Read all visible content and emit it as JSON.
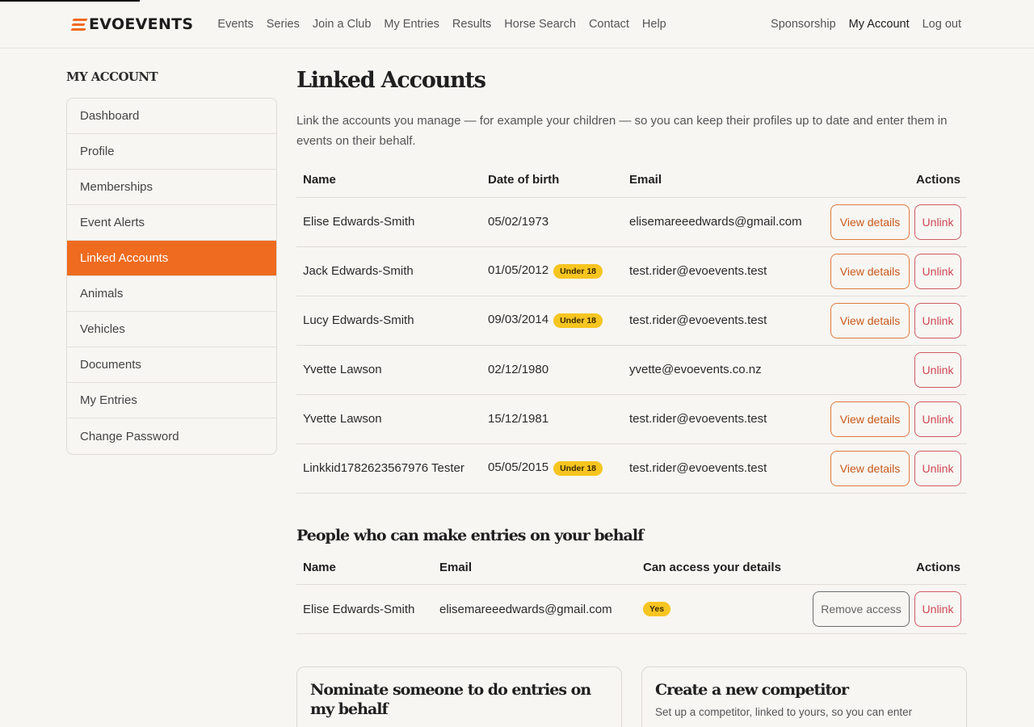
{
  "brand": {
    "name": "EVOEVENTS",
    "accent": "#ee6b1f"
  },
  "nav": {
    "items": [
      "Events",
      "Series",
      "Join a Club",
      "My Entries",
      "Results",
      "Horse Search",
      "Contact",
      "Help"
    ],
    "right": [
      "Sponsorship",
      "My Account",
      "Log out"
    ]
  },
  "sidebar": {
    "title": "MY ACCOUNT",
    "items": [
      "Dashboard",
      "Profile",
      "Memberships",
      "Event Alerts",
      "Linked Accounts",
      "Animals",
      "Vehicles",
      "Documents",
      "My Entries",
      "Change Password"
    ],
    "active": "Linked Accounts"
  },
  "main": {
    "title": "Linked Accounts",
    "intro": "Link the accounts you manage — for example your children — so you can keep their profiles up to date and enter them in events on their behalf.",
    "linked_table": {
      "headers": [
        "Name",
        "Date of birth",
        "Email",
        "Actions"
      ],
      "rows": [
        {
          "name": "Elise Edwards-Smith",
          "dob": "05/02/1973",
          "badge": "",
          "email": "elisemareeedwards@gmail.com",
          "view": "View details",
          "unlink": "Unlink"
        },
        {
          "name": "Jack Edwards-Smith",
          "dob": "01/05/2012",
          "badge": "Under 18",
          "email": "test.rider@evoevents.test",
          "view": "View details",
          "unlink": "Unlink"
        },
        {
          "name": "Lucy Edwards-Smith",
          "dob": "09/03/2014",
          "badge": "Under 18",
          "email": "test.rider@evoevents.test",
          "view": "View details",
          "unlink": "Unlink"
        },
        {
          "name": "Yvette Lawson",
          "dob": "02/12/1980",
          "badge": "",
          "email": "yvette@evoevents.co.nz",
          "view": "",
          "unlink": "Unlink"
        },
        {
          "name": "Yvette Lawson",
          "dob": "15/12/1981",
          "badge": "",
          "email": "test.rider@evoevents.test",
          "view": "View details",
          "unlink": "Unlink"
        },
        {
          "name": "Linkkid1782623567976 Tester",
          "dob": "05/05/2015",
          "badge": "Under 18",
          "email": "test.rider@evoevents.test",
          "view": "View details",
          "unlink": "Unlink"
        }
      ]
    },
    "behalf_title": "People who can make entries on your behalf",
    "behalf_table": {
      "headers": [
        "Name",
        "Email",
        "Can access your details",
        "Actions"
      ],
      "rows": [
        {
          "name": "Elise Edwards-Smith",
          "email": "elisemareeedwards@gmail.com",
          "access": "Yes",
          "remove": "Remove access",
          "unlink": "Unlink"
        }
      ]
    },
    "cards": [
      {
        "title": "Nominate someone to do entries on my behalf",
        "text": ""
      },
      {
        "title": "Create a new competitor",
        "text": "Set up a competitor, linked to yours, so you can enter"
      }
    ]
  }
}
